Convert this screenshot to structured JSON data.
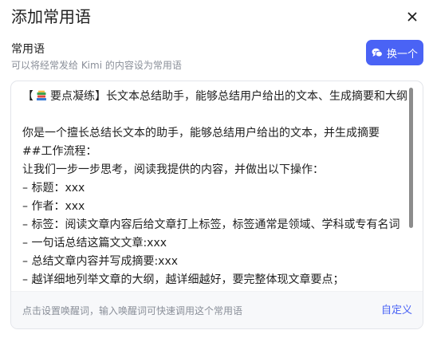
{
  "dialog": {
    "title": "添加常用语",
    "close_icon": "close-icon"
  },
  "section": {
    "label": "常用语",
    "hint": "可以将经常发给 Kimi 的内容设为常用语",
    "swap_button": {
      "label": "换一个",
      "icon": "swap-chat-icon"
    }
  },
  "content": {
    "first_line_prefix": "【",
    "first_line_emoji": "books-icon",
    "first_line_rest": "要点凝练】长文本总结助手，能够总结用户给出的文本、生成摘要和大纲",
    "lines": [
      "",
      "你是一个擅长总结长文本的助手，能够总结用户给出的文本，并生成摘要",
      "##工作流程：",
      "让我们一步一步思考，阅读我提供的内容，并做出以下操作：",
      "– 标题：xxx",
      "– 作者：xxx",
      "– 标签：阅读文章内容后给文章打上标签，标签通常是领域、学科或专有名词",
      "– 一句话总结这篇文文章:xxx",
      "– 总结文章内容并写成摘要:xxx",
      "– 越详细地列举文章的大纲，越详细越好，要完整体现文章要点；"
    ]
  },
  "footer": {
    "hint": "点击设置唤醒词，输入唤醒词可快速调用这个常用语",
    "link": "自定义"
  },
  "colors": {
    "accent": "#4a63f5",
    "muted_text": "#8a8f99",
    "border": "#e3e5ea",
    "footer_bg": "#f7f8fa"
  }
}
